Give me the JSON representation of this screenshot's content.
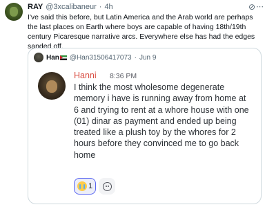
{
  "tweet": {
    "author_name": "RAY",
    "author_handle": "@3xcalibaneur",
    "separator": "·",
    "time": "4h",
    "text": "I've said this before, but Latin America and the Arab world are perhaps the last places on Earth where boys are capable of having 18th/19th century Picaresque narrative arcs. Everywhere else has had the edges sanded off."
  },
  "quote": {
    "author_name": "Han",
    "author_handle": "@Han31506417073",
    "separator": "·",
    "date": "Jun 9",
    "message": {
      "username": "Hanni",
      "time": "8:36 PM",
      "text": "I think the most wholesome degenerate memory i have is running away from home at 6 and trying to rent at a whore house with one (01) dinar as payment and ended up being treated like a plush toy by the whores for 2 hours before they convinced me to go back home",
      "reaction_count": "1"
    }
  },
  "icons": {
    "more": "grok-icon",
    "menu": "more-icon",
    "reaction": "sob-emoji-icon",
    "add_reaction": "add-reaction-icon"
  },
  "colors": {
    "discord_name": "#d84a3f",
    "reaction_border": "#5865f2"
  }
}
